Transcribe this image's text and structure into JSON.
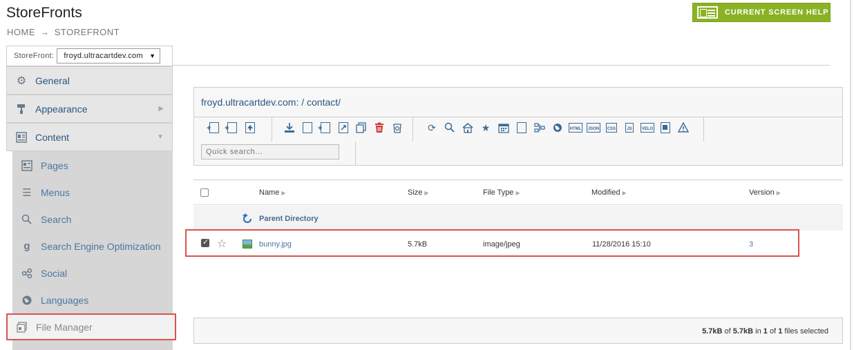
{
  "header": {
    "title": "StoreFronts",
    "breadcrumb": [
      "HOME",
      "STOREFRONT"
    ],
    "breadcrumb_arrow": "→",
    "help_button": "CURRENT SCREEN HELP"
  },
  "sidebar": {
    "storefront_label": "StoreFront:",
    "storefront_value": "froyd.ultracartdev.com",
    "items": [
      {
        "label": "General",
        "icon": "gear-icon"
      },
      {
        "label": "Appearance",
        "icon": "paint-roller-icon"
      },
      {
        "label": "Content",
        "icon": "content-icon"
      }
    ],
    "subitems": [
      {
        "label": "Pages",
        "icon": "pages-icon"
      },
      {
        "label": "Menus",
        "icon": "menu-icon"
      },
      {
        "label": "Search",
        "icon": "search-icon"
      },
      {
        "label": "Search Engine Optimization",
        "icon": "seo-icon"
      },
      {
        "label": "Social",
        "icon": "social-icon"
      },
      {
        "label": "Languages",
        "icon": "globe-icon"
      }
    ],
    "active_item": {
      "label": "File Manager",
      "icon": "file-manager-icon"
    }
  },
  "file_manager": {
    "path": "froyd.ultracartdev.com: /  contact/",
    "quick_search_placeholder": "Quick search...",
    "toolbar_tags": {
      "html": "HTML",
      "json": "JSON",
      "css": "CSS",
      "js": "JS",
      "velo": "VELO"
    },
    "columns": {
      "name": "Name",
      "size": "Size",
      "type": "File Type",
      "modified": "Modified",
      "version": "Version"
    },
    "parent_directory": "Parent Directory",
    "files": [
      {
        "name": "bunny.jpg",
        "size": "5.7kB",
        "type": "image/jpeg",
        "modified": "11/28/2016 15:10",
        "version": "3",
        "checked": true
      }
    ],
    "status": {
      "selected_size": "5.7kB",
      "of_text": "of",
      "total_size": "5.7kB",
      "in_text": "in",
      "selected_count": "1",
      "of_text2": "of",
      "total_count": "1",
      "suffix": "files selected"
    }
  }
}
